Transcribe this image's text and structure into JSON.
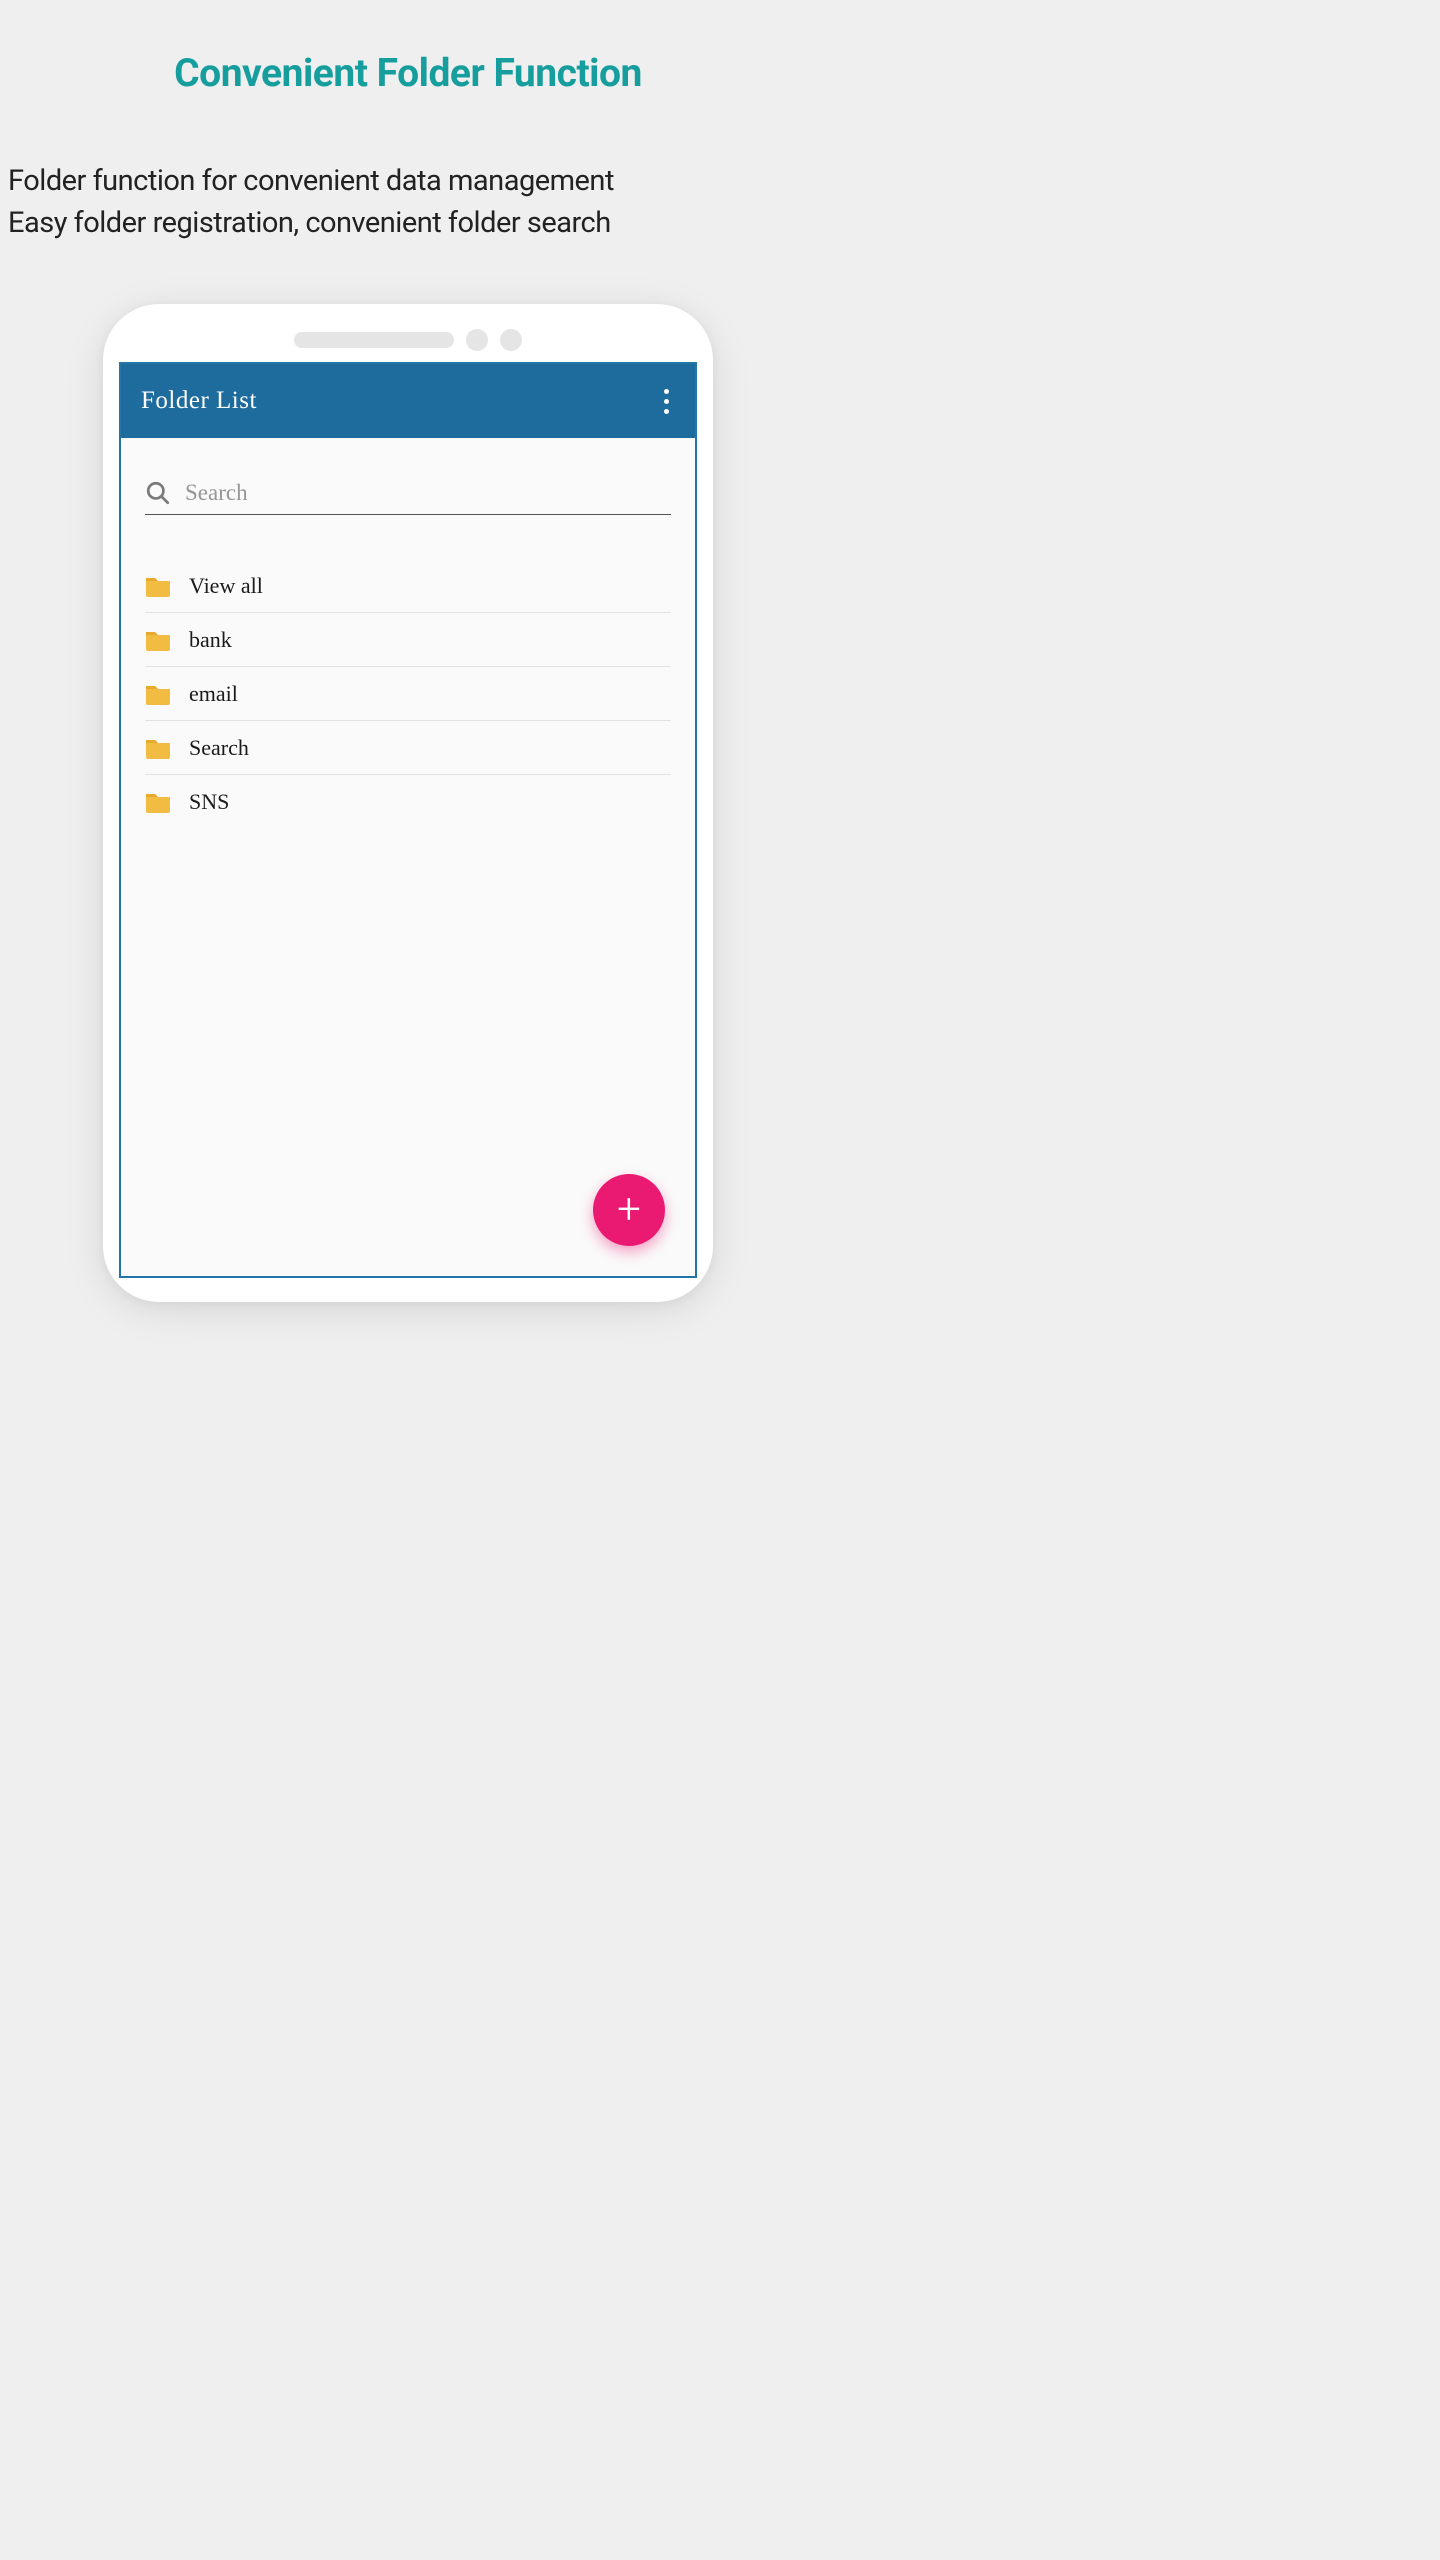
{
  "page": {
    "title": "Convenient Folder Function",
    "desc1": "Folder function for convenient data management",
    "desc2": "Easy folder registration, convenient folder search"
  },
  "app": {
    "bar_title": "Folder List",
    "search_placeholder": "Search"
  },
  "folders": {
    "items": [
      {
        "label": "View all"
      },
      {
        "label": "bank"
      },
      {
        "label": "email"
      },
      {
        "label": "Search"
      },
      {
        "label": "SNS"
      }
    ]
  },
  "fab": {
    "glyph": "+"
  },
  "colors": {
    "accent": "#169d9d",
    "bar": "#1e6c9e",
    "fab": "#ea1a72",
    "folder": "#f2bb42"
  }
}
